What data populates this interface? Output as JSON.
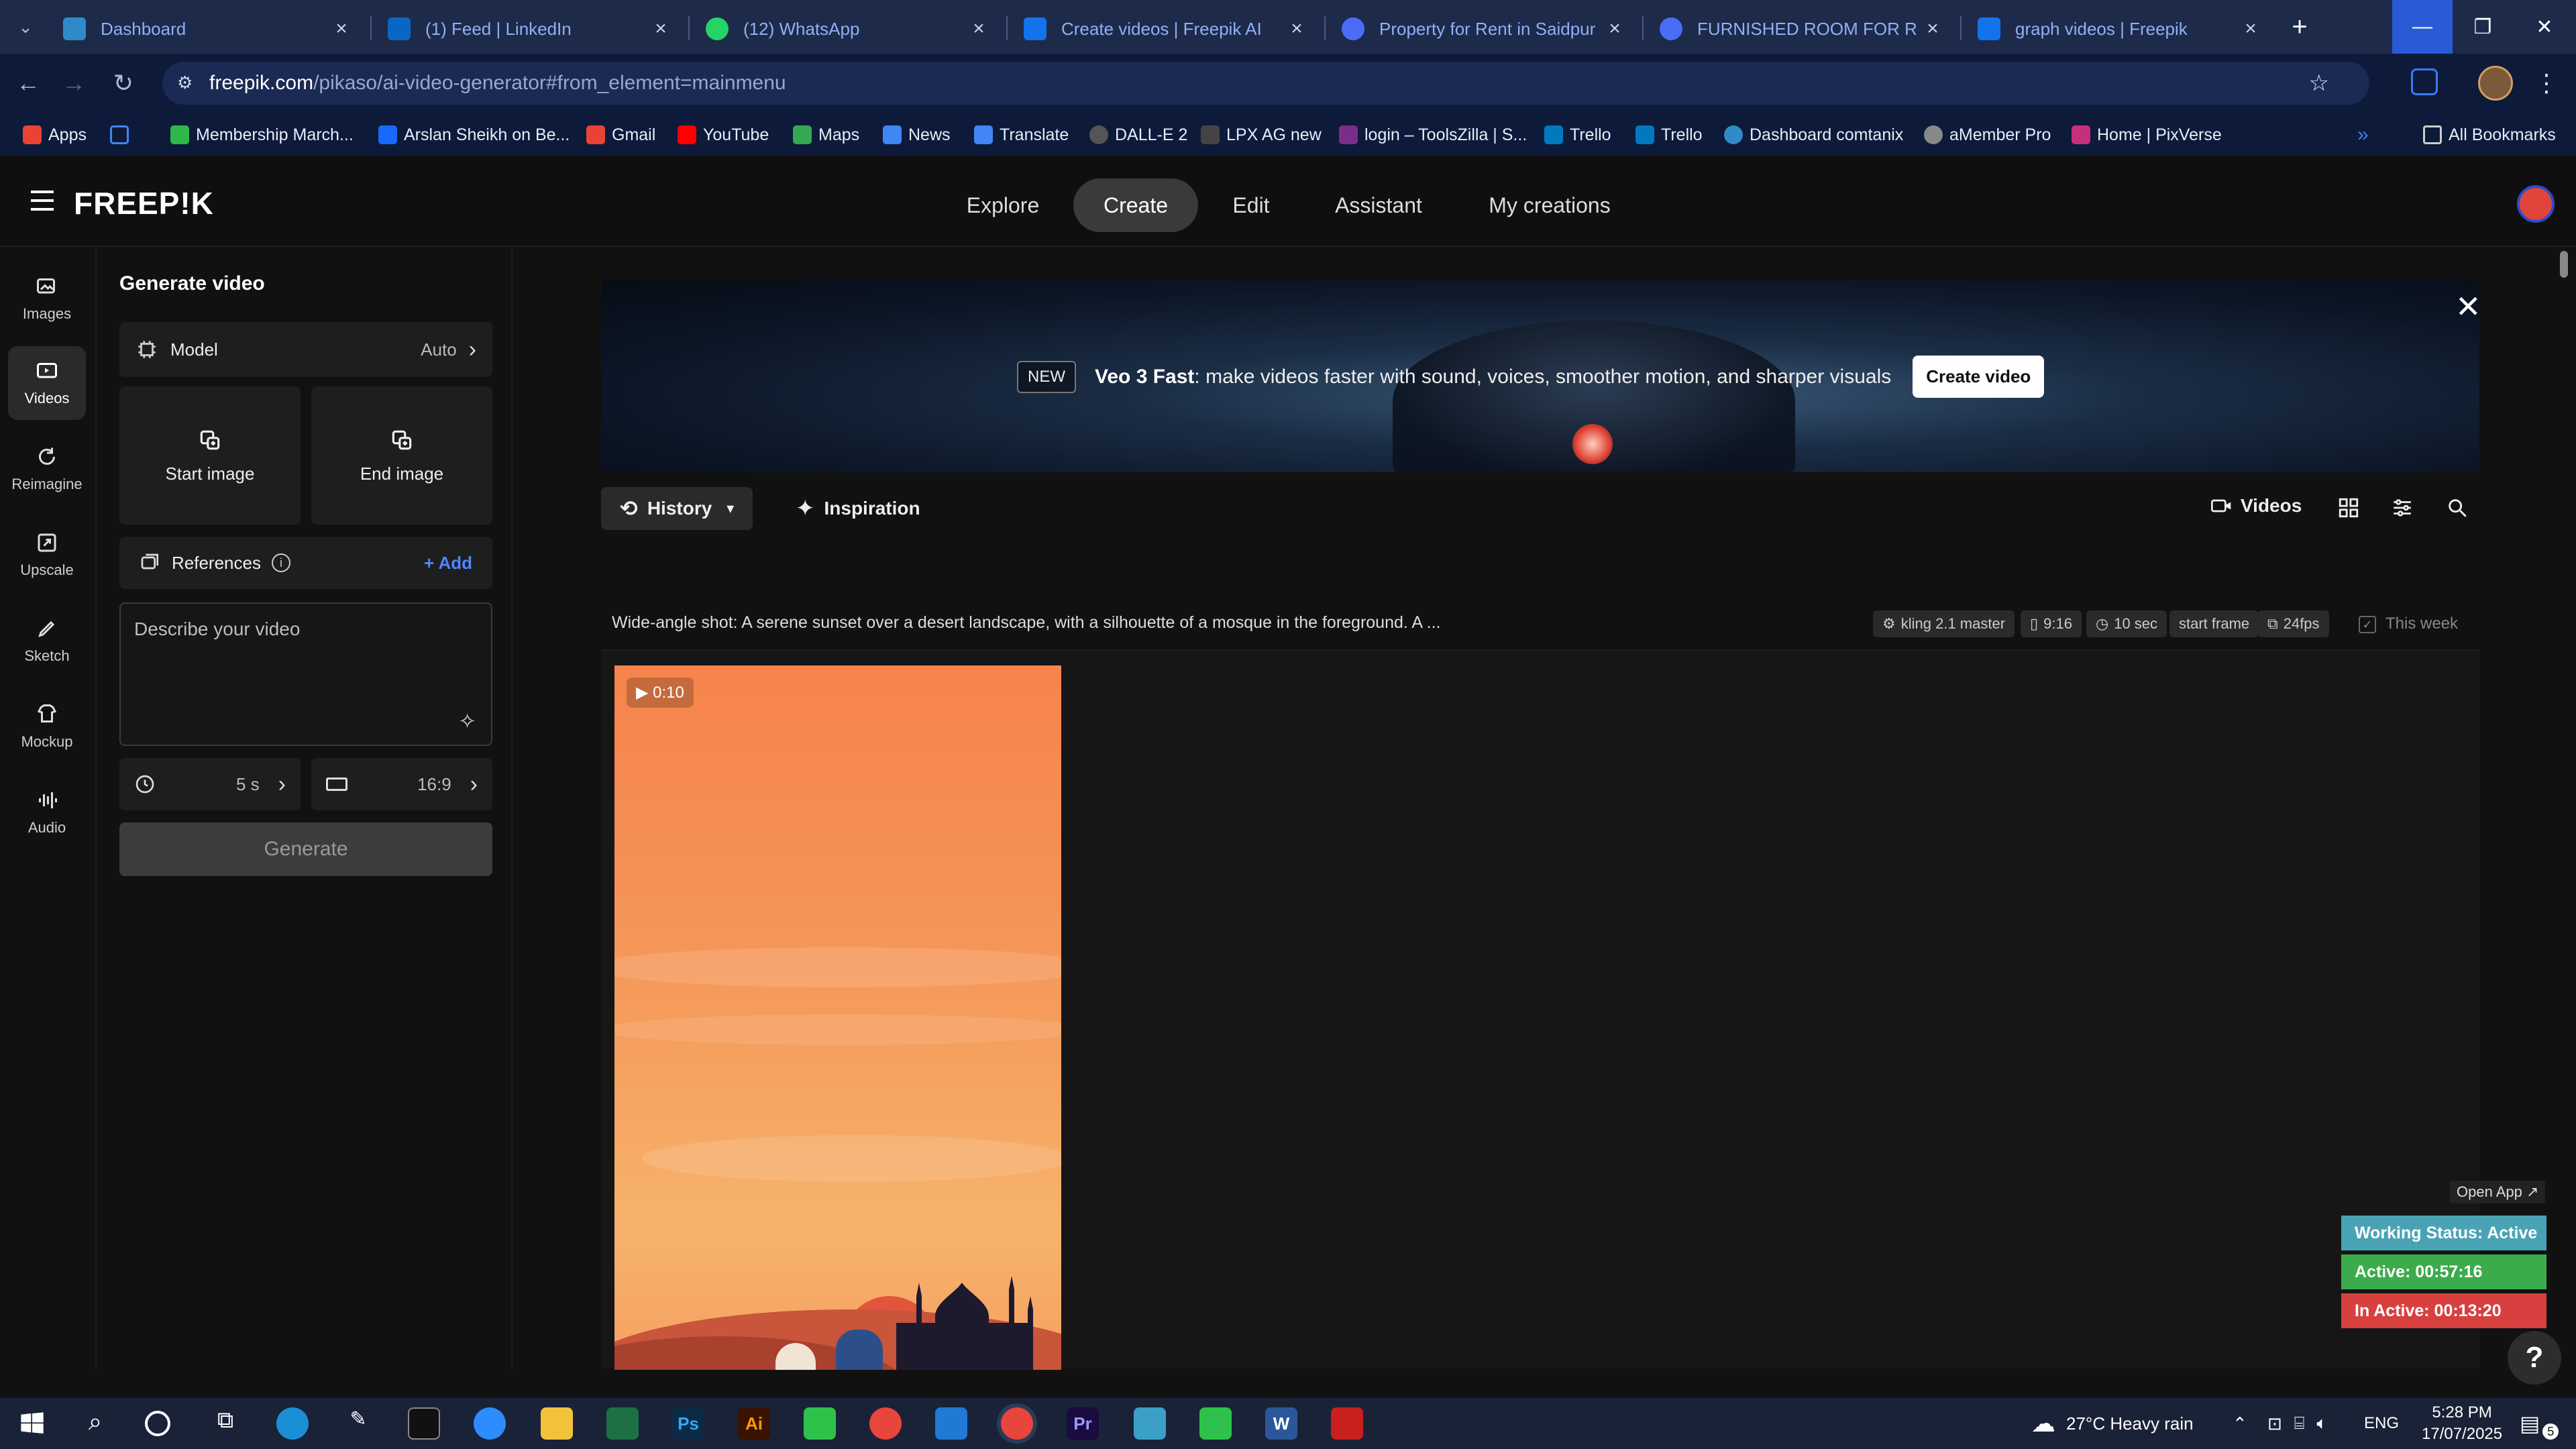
{
  "browser": {
    "tabs": [
      {
        "title": "Dashboard",
        "color": "#2e8bc7"
      },
      {
        "title": "(1) Feed | LinkedIn",
        "color": "#0a66c2"
      },
      {
        "title": "(12) WhatsApp",
        "color": "#25d366"
      },
      {
        "title": "Create videos | Freepik AI",
        "color": "#1273eb"
      },
      {
        "title": "Property for Rent in Saidpur Ro",
        "color": "#4a6cf7"
      },
      {
        "title": "FURNISHED ROOM FOR RENT",
        "color": "#4a6cf7"
      },
      {
        "title": "graph videos | Freepik",
        "color": "#1273eb"
      }
    ],
    "url_host": "freepik.com",
    "url_path": "/pikaso/ai-video-generator#from_element=mainmenu",
    "bookmarks": [
      {
        "label": "Apps",
        "color": "#ea4335"
      },
      {
        "label": "",
        "color": "#4285f4"
      },
      {
        "label": "Membership March...",
        "color": "#2eb84b"
      },
      {
        "label": "Arslan Sheikh on Be...",
        "color": "#1769ff"
      },
      {
        "label": "Gmail",
        "color": "#ea4335"
      },
      {
        "label": "YouTube",
        "color": "#ff0000"
      },
      {
        "label": "Maps",
        "color": "#34a853"
      },
      {
        "label": "News",
        "color": "#4285f4"
      },
      {
        "label": "Translate",
        "color": "#4285f4"
      },
      {
        "label": "DALL-E 2",
        "color": "#555555"
      },
      {
        "label": "LPX AG new",
        "color": "#444444"
      },
      {
        "label": "login – ToolsZilla | S...",
        "color": "#7b2d8a"
      },
      {
        "label": "Trello",
        "color": "#0079bf"
      },
      {
        "label": "Trello",
        "color": "#0079bf"
      },
      {
        "label": "Dashboard comtanix",
        "color": "#2e8bc7"
      },
      {
        "label": "aMember Pro",
        "color": "#888888"
      },
      {
        "label": "Home | PixVerse",
        "color": "#c4307a"
      }
    ],
    "all_bookmarks": "All Bookmarks"
  },
  "app": {
    "logo": "FREEP!K",
    "nav": [
      "Explore",
      "Create",
      "Edit",
      "Assistant",
      "My creations"
    ],
    "active_nav": "Create"
  },
  "rail": [
    {
      "label": "Images"
    },
    {
      "label": "Videos"
    },
    {
      "label": "Reimagine"
    },
    {
      "label": "Upscale"
    },
    {
      "label": "Sketch"
    },
    {
      "label": "Mockup"
    },
    {
      "label": "Audio"
    }
  ],
  "generate": {
    "title": "Generate video",
    "model_label": "Model",
    "model_value": "Auto",
    "start_image": "Start image",
    "end_image": "End image",
    "references": "References",
    "add": "+ Add",
    "prompt_placeholder": "Describe your video",
    "duration": "5 s",
    "aspect": "16:9",
    "generate_btn": "Generate"
  },
  "banner": {
    "badge": "NEW",
    "headline_bold": "Veo 3 Fast",
    "headline_rest": ": make videos faster with sound, voices, smoother motion, and sharper visuals",
    "cta": "Create video"
  },
  "toolbar": {
    "history": "History",
    "inspiration": "Inspiration",
    "videos": "Videos"
  },
  "generation": {
    "prompt": "Wide-angle shot: A serene sunset over a desert landscape, with a silhouette of a mosque in the foreground. A ...",
    "model": "kling 2.1 master",
    "ratio": "9:16",
    "length": "10 sec",
    "frame": "start frame",
    "fps": "24fps",
    "period": "This week",
    "thumb_duration": "▶ 0:10"
  },
  "tracker": {
    "open_app": "Open App ↗",
    "status": "Working Status: Active",
    "active": "Active: 00:57:16",
    "inactive": "In Active: 00:13:20",
    "colors": {
      "status": "#4aa3b5",
      "active": "#3cab4c",
      "inactive": "#d84040"
    }
  },
  "taskbar": {
    "weather": "27°C  Heavy rain",
    "lang": "ENG",
    "time": "5:28 PM",
    "date": "17/07/2025",
    "notif": "5"
  }
}
